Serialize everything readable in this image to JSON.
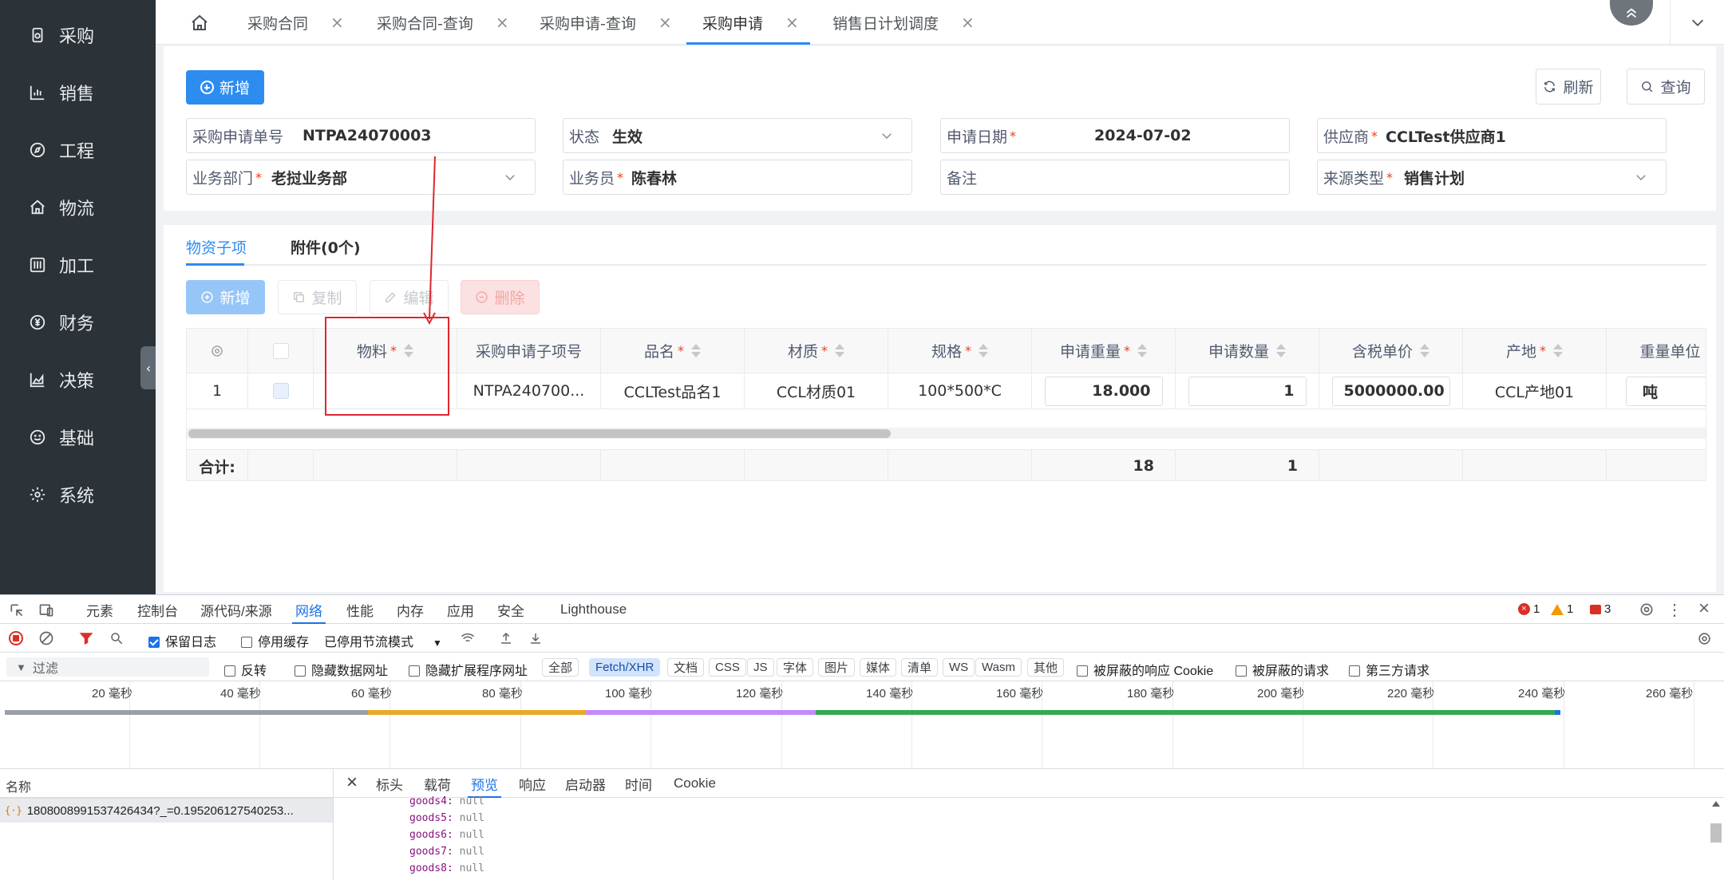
{
  "sidebar": {
    "items": [
      {
        "label": "采购",
        "icon": "purchase-icon"
      },
      {
        "label": "销售",
        "icon": "sales-chart-icon"
      },
      {
        "label": "工程",
        "icon": "compass-icon"
      },
      {
        "label": "物流",
        "icon": "home-icon"
      },
      {
        "label": "加工",
        "icon": "sliders-icon"
      },
      {
        "label": "财务",
        "icon": "yen-circle-icon"
      },
      {
        "label": "决策",
        "icon": "area-chart-icon"
      },
      {
        "label": "基础",
        "icon": "smile-icon"
      },
      {
        "label": "系统",
        "icon": "gear-icon"
      }
    ],
    "collapse_glyph": "‹"
  },
  "tabs": [
    {
      "label": "采购合同",
      "close": "×"
    },
    {
      "label": "采购合同-查询",
      "close": "×"
    },
    {
      "label": "采购申请-查询",
      "close": "×"
    },
    {
      "label": "采购申请",
      "close": "×",
      "active": true
    },
    {
      "label": "销售日计划调度",
      "close": "×"
    }
  ],
  "toolbar": {
    "add_label": "新增",
    "refresh_label": "刷新",
    "query_label": "查询"
  },
  "form": {
    "order_no": {
      "label": "采购申请单号",
      "value": "NTPA24070003"
    },
    "status": {
      "label": "状态",
      "value": "生效"
    },
    "apply_date": {
      "label": "申请日期",
      "required": "*",
      "value": "2024-07-02"
    },
    "supplier": {
      "label": "供应商",
      "required": "*",
      "value": "CCLTest供应商1"
    },
    "department": {
      "label": "业务部门",
      "required": "*",
      "value": "老挝业务部"
    },
    "salesman": {
      "label": "业务员",
      "required": "*",
      "value": "陈春林"
    },
    "remark": {
      "label": "备注",
      "value": ""
    },
    "source_type": {
      "label": "来源类型",
      "required": "*",
      "value": "销售计划"
    }
  },
  "subtabs": [
    {
      "label": "物资子项",
      "active": true
    },
    {
      "label": "附件(0个)"
    }
  ],
  "sub_toolbar": {
    "add": "新增",
    "copy": "复制",
    "edit": "编辑",
    "delete": "删除"
  },
  "table": {
    "headers": [
      {
        "label": "",
        "sortable": false
      },
      {
        "label": "",
        "sortable": false
      },
      {
        "label": "物料",
        "required": "*",
        "sortable": true
      },
      {
        "label": "采购申请子项号",
        "sortable": false
      },
      {
        "label": "品名",
        "required": "*",
        "sortable": true
      },
      {
        "label": "材质",
        "required": "*",
        "sortable": true
      },
      {
        "label": "规格",
        "required": "*",
        "sortable": true
      },
      {
        "label": "申请重量",
        "required": "*",
        "sortable": true
      },
      {
        "label": "申请数量",
        "sortable": true
      },
      {
        "label": "含税单价",
        "sortable": true
      },
      {
        "label": "产地",
        "required": "*",
        "sortable": true
      },
      {
        "label": "重量单位",
        "sortable": true
      }
    ],
    "rows": [
      {
        "index": "1",
        "material": "",
        "item_no": "NTPA240700...",
        "product_name": "CCLTest品名1",
        "material_grade": "CCL材质01",
        "spec": "100*500*C",
        "weight": "18.000",
        "quantity": "1",
        "unit_price": "5000000.00",
        "origin": "CCL产地01",
        "weight_unit": "吨"
      }
    ],
    "summary": {
      "label": "合计:",
      "weight": "18",
      "quantity": "1"
    }
  },
  "devtools": {
    "tabs": [
      {
        "label": "元素"
      },
      {
        "label": "控制台"
      },
      {
        "label": "源代码/来源"
      },
      {
        "label": "网络",
        "active": true
      },
      {
        "label": "性能"
      },
      {
        "label": "内存"
      },
      {
        "label": "应用"
      },
      {
        "label": "安全"
      },
      {
        "label": "Lighthouse"
      }
    ],
    "errors": "1",
    "warnings": "1",
    "issues": "3",
    "preserve_log": "保留日志",
    "disable_cache": "停用缓存",
    "throttle": "已停用节流模式",
    "filter_placeholder": "过滤",
    "invert": "反转",
    "hide_data_urls": "隐藏数据网址",
    "hide_ext_urls": "隐藏扩展程序网址",
    "type_filters": [
      {
        "label": "全部"
      },
      {
        "label": "Fetch/XHR",
        "active": true
      },
      {
        "label": "文档"
      },
      {
        "label": "CSS"
      },
      {
        "label": "JS"
      },
      {
        "label": "字体"
      },
      {
        "label": "图片"
      },
      {
        "label": "媒体"
      },
      {
        "label": "清单"
      },
      {
        "label": "WS"
      },
      {
        "label": "Wasm"
      },
      {
        "label": "其他"
      }
    ],
    "blocked_cookies": "被屏蔽的响应 Cookie",
    "blocked_requests": "被屏蔽的请求",
    "third_party": "第三方请求",
    "timeline_labels": [
      "20 毫秒",
      "40 毫秒",
      "60 毫秒",
      "80 毫秒",
      "100 毫秒",
      "120 毫秒",
      "140 毫秒",
      "160 毫秒",
      "180 毫秒",
      "200 毫秒",
      "220 毫秒",
      "240 毫秒",
      "260 毫秒"
    ],
    "name_header": "名称",
    "request_name": "1808008991537426434?_=0.195206127540253...",
    "detail_tabs": [
      {
        "label": "标头"
      },
      {
        "label": "载荷"
      },
      {
        "label": "预览",
        "active": true
      },
      {
        "label": "响应"
      },
      {
        "label": "启动器"
      },
      {
        "label": "时间"
      },
      {
        "label": "Cookie"
      }
    ],
    "preview_lines": [
      {
        "key": "goods4:",
        "value": "null"
      },
      {
        "key": "goods5:",
        "value": "null"
      },
      {
        "key": "goods6:",
        "value": "null"
      },
      {
        "key": "goods7:",
        "value": "null"
      },
      {
        "key": "goods8:",
        "value": "null"
      }
    ]
  },
  "colors": {
    "primary": "#2d8cf0",
    "sidebar_bg": "#2b3238",
    "required": "#ed4014",
    "annotation": "#e0262d"
  }
}
